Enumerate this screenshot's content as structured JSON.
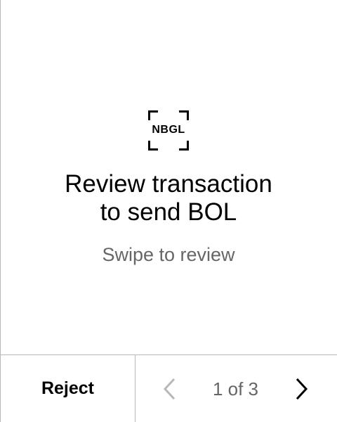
{
  "logo": {
    "text": "NBGL",
    "icon": "nbgl-frame-logo-icon"
  },
  "review": {
    "title_line1": "Review transaction",
    "title_line2": "to send BOL",
    "subtitle": "Swipe to review"
  },
  "footer": {
    "reject_label": "Reject",
    "page_indicator": "1 of 3",
    "current_page": 1,
    "total_pages": 3,
    "prev_icon": "chevron-left-icon",
    "next_icon": "chevron-right-icon"
  },
  "colors": {
    "background": "#ffffff",
    "text": "#000000",
    "secondary_text": "#666666",
    "divider": "#b8b8b8",
    "disabled_icon": "#b8b8b8"
  }
}
